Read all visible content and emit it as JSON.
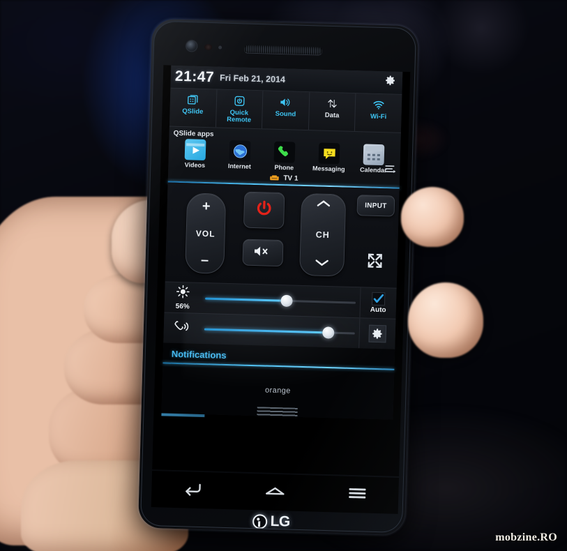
{
  "statusbar": {
    "time": "21:47",
    "date": "Fri Feb 21, 2014",
    "settings_icon": "gear-icon"
  },
  "quick_toggles": [
    {
      "label": "QSlide",
      "icon": "qslide-grid-icon",
      "state": "on",
      "color": "#3ec6f5"
    },
    {
      "label": "Quick\nRemote",
      "label_line1": "Quick",
      "label_line2": "Remote",
      "icon": "power-rounded-icon",
      "state": "on",
      "color": "#3ec6f5"
    },
    {
      "label": "Sound",
      "icon": "speaker-icon",
      "state": "on",
      "color": "#3ec6f5"
    },
    {
      "label": "Data",
      "icon": "data-arrows-icon",
      "state": "off",
      "color": "#dfe4ea"
    },
    {
      "label": "Wi-Fi",
      "icon": "wifi-icon",
      "state": "on",
      "color": "#3ec6f5"
    }
  ],
  "qslide": {
    "title": "QSlide apps",
    "edit_icon": "edit-list-icon",
    "apps": [
      {
        "label": "Videos",
        "icon": "video-play-icon"
      },
      {
        "label": "Internet",
        "icon": "browser-globe-icon"
      },
      {
        "label": "Phone",
        "icon": "phone-handset-icon"
      },
      {
        "label": "Messaging",
        "icon": "message-smiley-icon"
      },
      {
        "label": "Calendar",
        "icon": "calendar-icon"
      }
    ]
  },
  "quick_remote": {
    "device_label": "TV 1",
    "device_icon": "sofa-icon",
    "buttons": {
      "vol_up": "+",
      "vol_label": "VOL",
      "vol_down": "–",
      "power": "power-icon",
      "mute": "mute-speaker-icon",
      "ch_up": "chevron-up-icon",
      "ch_label": "CH",
      "ch_down": "chevron-down-icon",
      "input": "INPUT",
      "expand": "expand-arrows-icon"
    },
    "power_color": "#e32219"
  },
  "sliders": {
    "brightness": {
      "icon": "brightness-sun-icon",
      "value_label": "56%",
      "value": 56,
      "auto_label": "Auto",
      "auto_checked": true,
      "check_icon": "checkmark-icon"
    },
    "volume": {
      "icon": "ringer-call-icon",
      "value": 85,
      "settings_icon": "gear-icon"
    }
  },
  "notifications": {
    "title": "Notifications",
    "carrier": "orange"
  },
  "navbar": [
    {
      "name": "back",
      "icon": "back-arrow-icon"
    },
    {
      "name": "home",
      "icon": "home-icon"
    },
    {
      "name": "menu",
      "icon": "menu-lines-icon"
    }
  ],
  "device": {
    "brand": "LG"
  },
  "watermark": "mobzine.RO",
  "colors": {
    "accent_cyan": "#3ec6f5",
    "slider_blue": "#45b7f0",
    "power_red": "#e32219",
    "inactive_white": "#dfe4ea",
    "sofa_orange": "#f2a01e"
  }
}
